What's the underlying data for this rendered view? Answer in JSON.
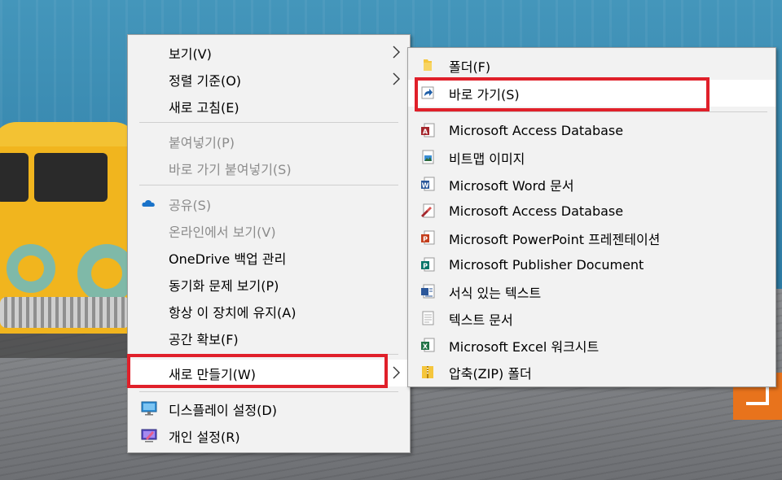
{
  "main_menu": {
    "items": [
      {
        "label": "보기(V)",
        "disabled": false,
        "has_submenu": true
      },
      {
        "label": "정렬 기준(O)",
        "disabled": false,
        "has_submenu": true
      },
      {
        "label": "새로 고침(E)",
        "disabled": false,
        "has_submenu": false
      },
      {
        "label": "붙여넣기(P)",
        "disabled": true,
        "has_submenu": false
      },
      {
        "label": "바로 가기 붙여넣기(S)",
        "disabled": true,
        "has_submenu": false
      },
      {
        "label": "공유(S)",
        "disabled": true,
        "has_submenu": false,
        "icon": "onedrive-cloud-icon"
      },
      {
        "label": "온라인에서 보기(V)",
        "disabled": true,
        "has_submenu": false
      },
      {
        "label": "OneDrive 백업 관리",
        "disabled": false,
        "has_submenu": false
      },
      {
        "label": "동기화 문제 보기(P)",
        "disabled": false,
        "has_submenu": false
      },
      {
        "label": "항상 이 장치에 유지(A)",
        "disabled": false,
        "has_submenu": false
      },
      {
        "label": "공간 확보(F)",
        "disabled": false,
        "has_submenu": false
      },
      {
        "label": "새로 만들기(W)",
        "disabled": false,
        "has_submenu": true,
        "highlighted": true
      },
      {
        "label": "디스플레이 설정(D)",
        "disabled": false,
        "has_submenu": false,
        "icon": "display-settings-icon"
      },
      {
        "label": "개인 설정(R)",
        "disabled": false,
        "has_submenu": false,
        "icon": "personalize-icon"
      }
    ]
  },
  "sub_menu": {
    "items": [
      {
        "label": "폴더(F)",
        "icon": "folder-icon"
      },
      {
        "label": "바로 가기(S)",
        "icon": "shortcut-icon",
        "highlighted": true
      },
      {
        "label": "Microsoft Access Database",
        "icon": "access-icon"
      },
      {
        "label": "비트맵 이미지",
        "icon": "bitmap-icon"
      },
      {
        "label": "Microsoft Word 문서",
        "icon": "word-icon"
      },
      {
        "label": "Microsoft Access Database",
        "icon": "access-icon"
      },
      {
        "label": "Microsoft PowerPoint 프레젠테이션",
        "icon": "powerpoint-icon"
      },
      {
        "label": "Microsoft Publisher Document",
        "icon": "publisher-icon"
      },
      {
        "label": "서식 있는 텍스트",
        "icon": "rich-text-icon"
      },
      {
        "label": "텍스트 문서",
        "icon": "text-document-icon"
      },
      {
        "label": "Microsoft Excel 워크시트",
        "icon": "excel-icon"
      },
      {
        "label": "압축(ZIP) 폴더",
        "icon": "zip-folder-icon"
      }
    ]
  },
  "colors": {
    "menu_bg": "#f2f2f2",
    "highlight_box": "#e0202a",
    "disabled_text": "#8c8c8c"
  }
}
